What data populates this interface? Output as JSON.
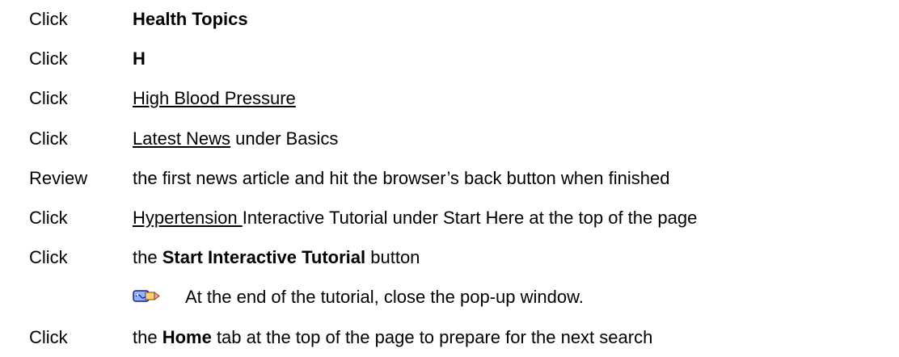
{
  "steps": [
    {
      "verb": "Click",
      "bold": "Health Topics"
    },
    {
      "verb": "Click",
      "bold": "H"
    },
    {
      "verb": "Click",
      "link": "High Blood Pressure"
    },
    {
      "verb": "Click",
      "link": "Latest News",
      "after": " under Basics"
    },
    {
      "verb": "Review",
      "text": "the first news article and hit the browser’s back button when finished"
    },
    {
      "verb": "Click",
      "link": "Hypertension ",
      "after": "Interactive Tutorial under Start Here at the top of the page"
    },
    {
      "verb": "Click",
      "before": "the ",
      "bold": "Start Interactive Tutorial",
      "after": " button"
    },
    {
      "verb": "Click",
      "before": "the ",
      "bold": "Home",
      "after": " tab at the top of the page to prepare for the next search"
    }
  ],
  "note": {
    "icon": "pencil-note-icon",
    "text": "At the end of the tutorial, close the pop-up window."
  }
}
